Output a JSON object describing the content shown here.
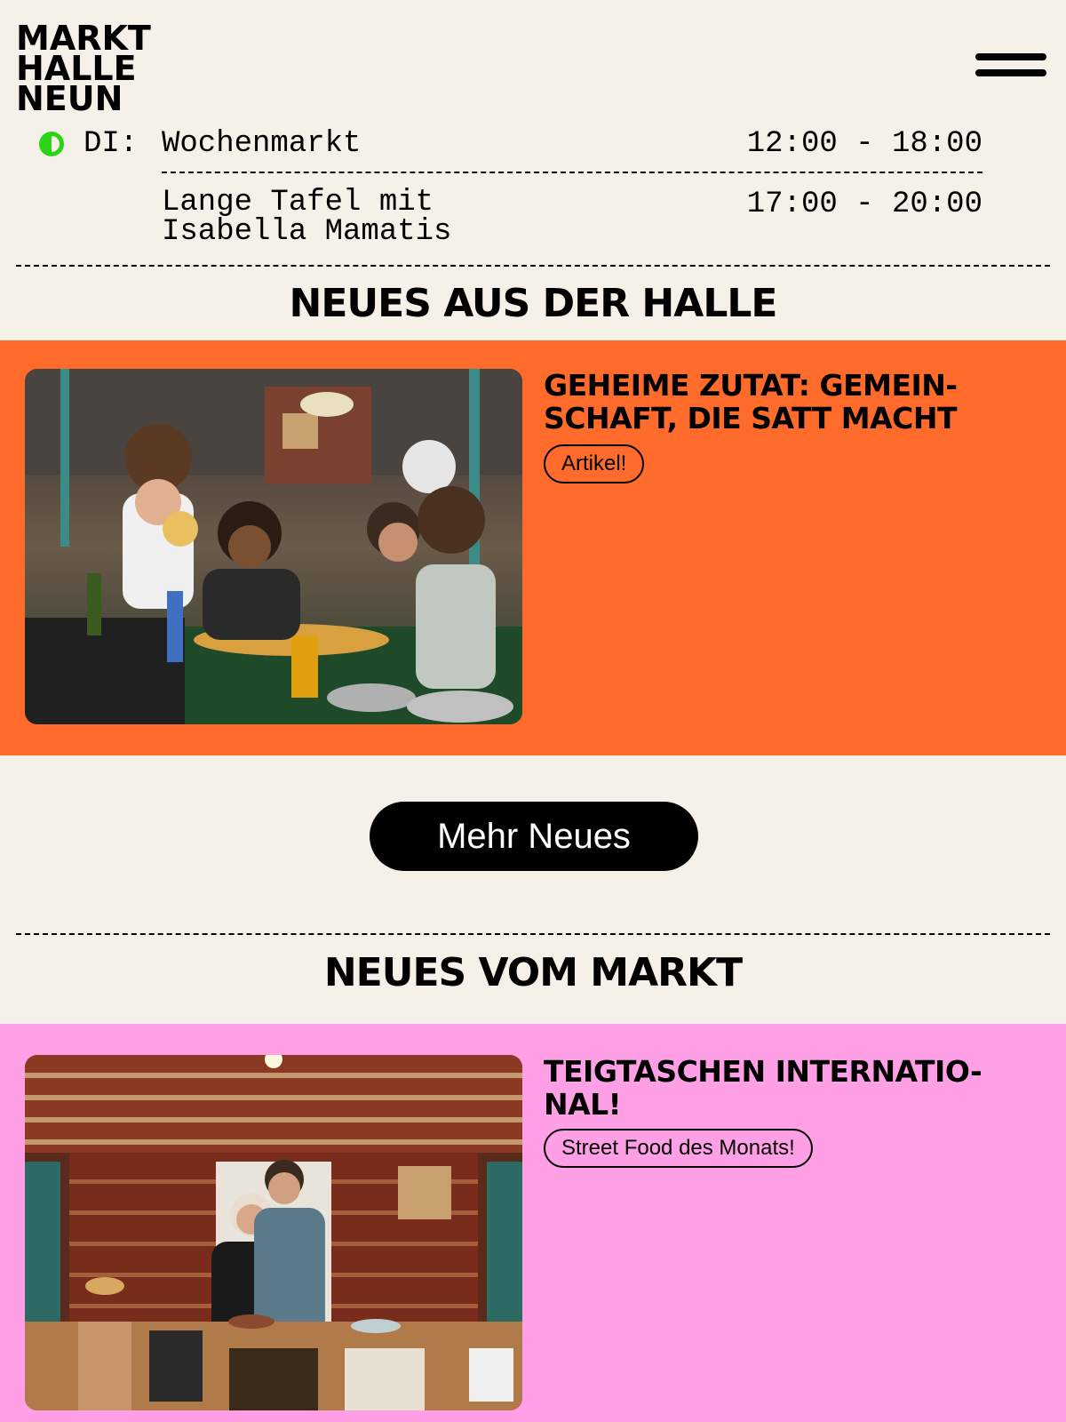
{
  "header": {
    "logo_lines": [
      "MARKT",
      "HALLE",
      "NEUN"
    ],
    "menu_icon": "hamburger-menu-icon"
  },
  "schedule": {
    "status_color": "#2bd418",
    "day": "DI:",
    "events": [
      {
        "title": "Wochenmarkt",
        "time": "12:00 - 18:00"
      },
      {
        "title_lines": [
          "Lange Tafel mit",
          "Isabella Mamatis"
        ],
        "time": "17:00 - 20:00"
      }
    ]
  },
  "halle": {
    "section_title": "NEUES AUS DER HALLE",
    "card": {
      "bg_color": "#ff6b2b",
      "title_lines": [
        "GEHEIME ZUTAT: GEMEIN-",
        "SCHAFT, DIE SATT MACHT"
      ],
      "tag": "Artikel!",
      "image": "children-cooking-photo"
    },
    "more_button": "Mehr Neues"
  },
  "markt": {
    "section_title": "NEUES VOM MARKT",
    "card": {
      "bg_color": "#ffa0e6",
      "title_lines": [
        "TEIGTASCHEN INTERNATIO-",
        "NAL!"
      ],
      "tag": "Street Food des Monats!",
      "image": "market-stall-couple-photo"
    }
  }
}
